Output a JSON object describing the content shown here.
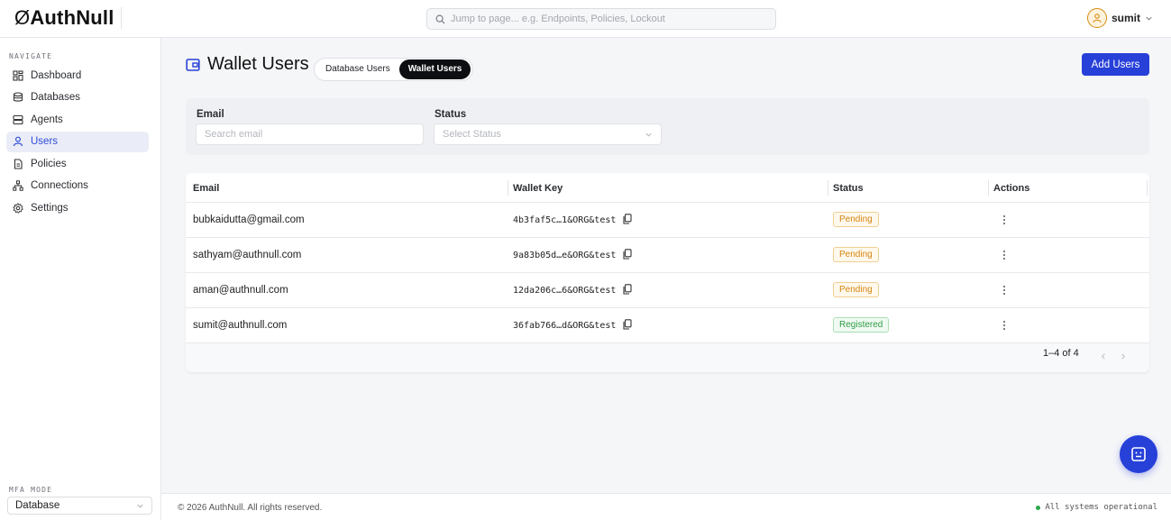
{
  "app": {
    "logo_prefix": "Ø",
    "logo_text": "AuthNull"
  },
  "search": {
    "placeholder": "Jump to page... e.g. Endpoints, Policies, Lockout"
  },
  "user": {
    "name": "sumit"
  },
  "sidebar": {
    "heading": "NAVIGATE",
    "items": [
      {
        "label": "Dashboard",
        "icon": "grid-icon"
      },
      {
        "label": "Databases",
        "icon": "database-icon"
      },
      {
        "label": "Agents",
        "icon": "server-icon"
      },
      {
        "label": "Users",
        "icon": "user-icon",
        "active": true
      },
      {
        "label": "Policies",
        "icon": "document-icon"
      },
      {
        "label": "Connections",
        "icon": "network-icon"
      },
      {
        "label": "Settings",
        "icon": "gear-icon"
      }
    ],
    "mfa_heading": "MFA MODE",
    "mfa_value": "Database"
  },
  "page": {
    "title": "Wallet Users",
    "tabs": [
      {
        "label": "Database Users"
      },
      {
        "label": "Wallet Users",
        "active": true
      }
    ],
    "add_button": "Add Users"
  },
  "filters": {
    "email_label": "Email",
    "email_placeholder": "Search email",
    "status_label": "Status",
    "status_placeholder": "Select Status"
  },
  "table": {
    "headers": {
      "email": "Email",
      "wallet_key": "Wallet Key",
      "status": "Status",
      "actions": "Actions"
    },
    "rows": [
      {
        "email": "bubkaidutta@gmail.com",
        "wallet_key": "4b3faf5c…1&ORG&test",
        "status": "Pending"
      },
      {
        "email": "sathyam@authnull.com",
        "wallet_key": "9a83b05d…e&ORG&test",
        "status": "Pending"
      },
      {
        "email": "aman@authnull.com",
        "wallet_key": "12da206c…6&ORG&test",
        "status": "Pending"
      },
      {
        "email": "sumit@authnull.com",
        "wallet_key": "36fab766…d&ORG&test",
        "status": "Registered"
      }
    ],
    "pagination": "1–4 of 4"
  },
  "footer": {
    "copyright": "© 2026 AuthNull. All rights reserved.",
    "status": "All systems operational"
  },
  "colors": {
    "accent": "#2740d8",
    "pending": "#d48611",
    "registered": "#2e9e43",
    "status_ok": "#2aa84a"
  }
}
